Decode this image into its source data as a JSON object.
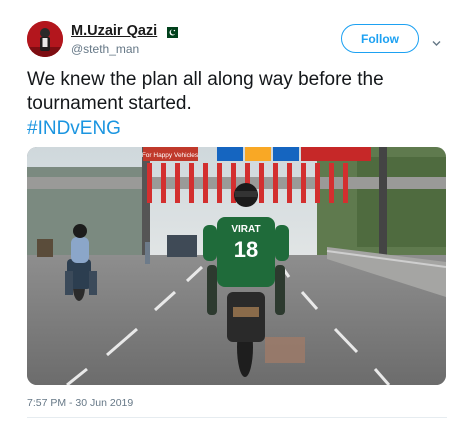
{
  "tweet": {
    "display_name": "M.Uzair Qazi",
    "handle": "@steth_man",
    "text": "We knew the plan all along way before the tournament started.",
    "hashtag": "#INDvENG",
    "timestamp": "7:57 PM - 30 Jun 2019"
  },
  "actions": {
    "follow_label": "Follow"
  },
  "media": {
    "banner_text": "For Happy Vehicles",
    "jersey_name": "VIRAT",
    "jersey_number": "18"
  },
  "colors": {
    "accent": "#1da1f2",
    "hashtag": "#1b95e0",
    "muted": "#657786",
    "jersey_green": "#1f6b3a",
    "flag_green": "#01411c"
  },
  "icons": [
    "avatar",
    "pakistan-flag-icon",
    "chevron-down-icon"
  ]
}
